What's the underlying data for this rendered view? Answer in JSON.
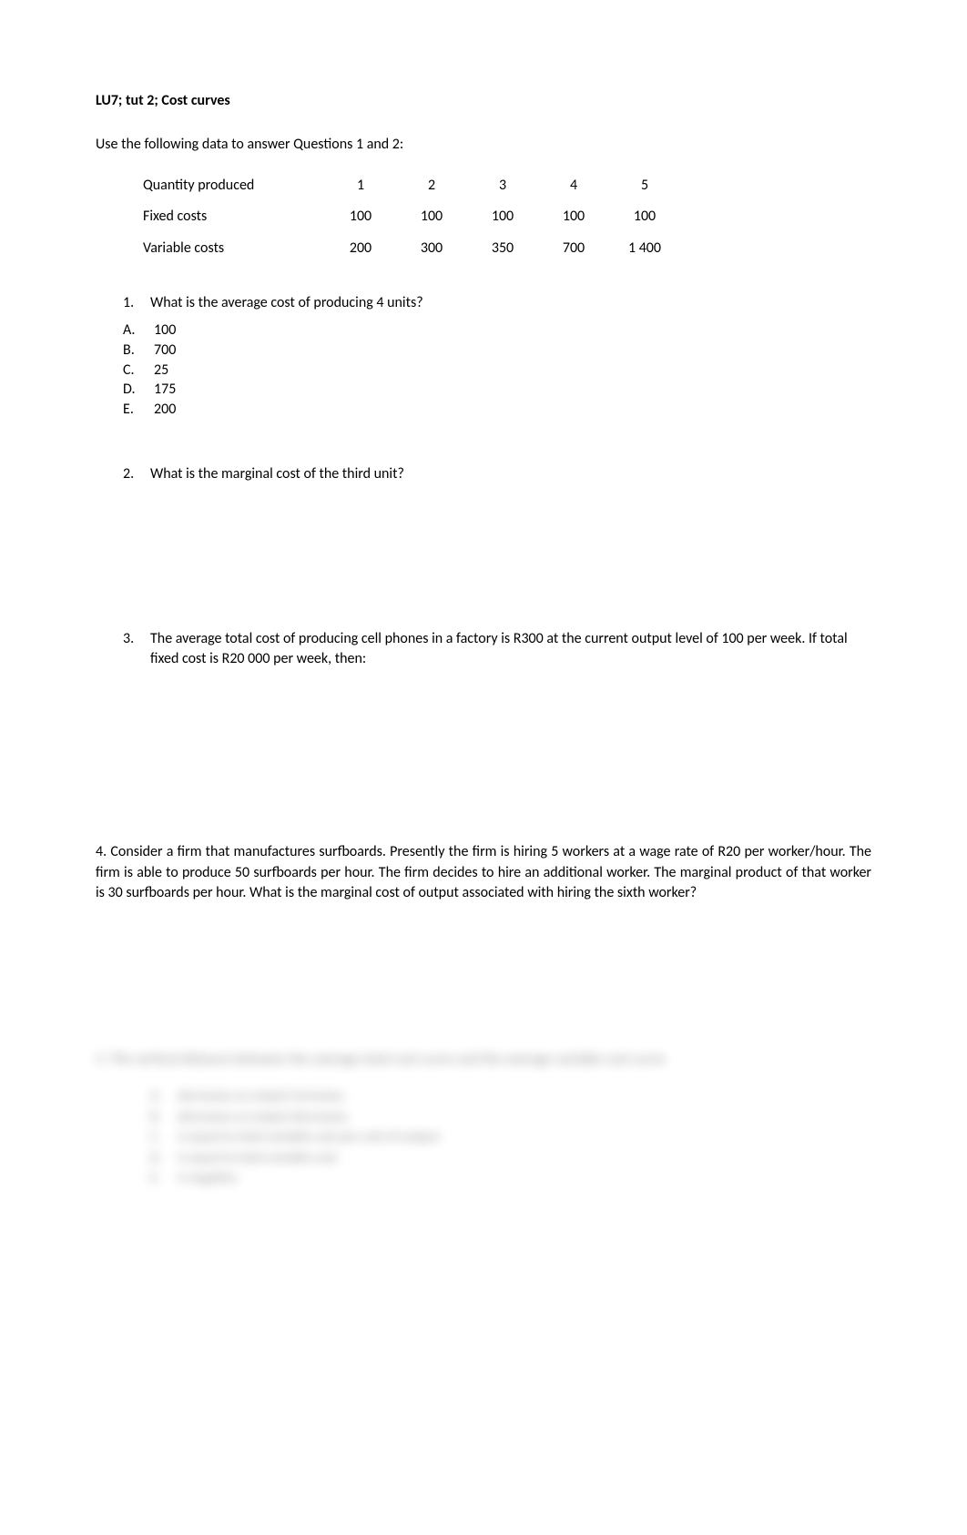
{
  "title": "LU7; tut 2; Cost curves",
  "intro": "Use the following data to answer Questions 1 and 2:",
  "table": {
    "rows": [
      {
        "label": "Quantity produced",
        "values": [
          "1",
          "2",
          "3",
          "4",
          "5"
        ]
      },
      {
        "label": "Fixed costs",
        "values": [
          "100",
          "100",
          "100",
          "100",
          "100"
        ]
      },
      {
        "label": "Variable costs",
        "values": [
          "200",
          "300",
          "350",
          "700",
          "1 400"
        ]
      }
    ]
  },
  "q1": {
    "number": "1.",
    "text": "What is the average cost of producing 4 units?",
    "options": [
      {
        "letter": "A.",
        "text": "100"
      },
      {
        "letter": "B.",
        "text": "700"
      },
      {
        "letter": "C.",
        "text": "25"
      },
      {
        "letter": "D.",
        "text": "175"
      },
      {
        "letter": "E.",
        "text": "200"
      }
    ]
  },
  "q2": {
    "number": "2.",
    "text": "What is the marginal cost of the third unit?"
  },
  "q3": {
    "number": "3.",
    "text": "The average total cost of producing cell phones in a factory is R300 at the current output level of 100 per week. If total fixed cost is R20 000 per week, then:"
  },
  "q4": {
    "text": "4. Consider a firm that manufactures surfboards. Presently the firm is hiring 5 workers at a wage rate of R20 per worker/hour. The firm is able to produce 50 surfboards per hour. The firm decides to hire an additional worker. The marginal product of that worker is 30 surfboards per hour. What is the marginal cost of output associated with hiring the sixth worker?"
  },
  "q5_blurred": {
    "text": "5. The vertical distance between the average total cost curve and the average variable cost curve",
    "options": [
      {
        "letter": "A.",
        "text": "decreases as output increases."
      },
      {
        "letter": "B.",
        "text": "decreases as output decreases."
      },
      {
        "letter": "C.",
        "text": "is equal to total variable cost per unit of output."
      },
      {
        "letter": "D.",
        "text": "is equal to total variable cost."
      },
      {
        "letter": "E.",
        "text": "is negative."
      }
    ]
  }
}
